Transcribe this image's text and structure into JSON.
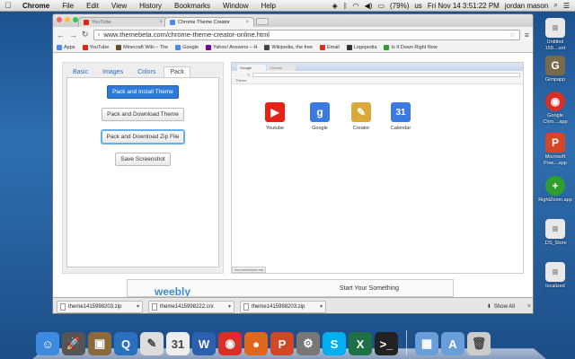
{
  "menubar": {
    "app": "Chrome",
    "items": [
      "File",
      "Edit",
      "View",
      "History",
      "Bookmarks",
      "Window",
      "Help"
    ],
    "battery": "(79%)",
    "lang": "us",
    "clock": "Fri Nov 14  3:51:22 PM",
    "user": "jordan mason"
  },
  "desktop": [
    {
      "label": "Untitled 159....ext",
      "icon": "document-icon",
      "color": "#e8e8e8",
      "glyph": "≡"
    },
    {
      "label": "Gimpapp",
      "icon": "gimp-icon",
      "color": "#7a6a4a",
      "glyph": "🐕"
    },
    {
      "label": "Google Chro....app",
      "icon": "chrome-icon",
      "color": "#d93025",
      "glyph": "◉"
    },
    {
      "label": "Microsoft Pow....app",
      "icon": "powerpoint-icon",
      "color": "#d24726",
      "glyph": "P"
    },
    {
      "label": "RightZoom.app",
      "icon": "rightzoom-icon",
      "color": "#2f9e2f",
      "glyph": "+"
    },
    {
      "label": ".DS_Store",
      "icon": "file-icon",
      "color": "#e8e8e8",
      "glyph": "≡"
    },
    {
      "label": "localized",
      "icon": "file-icon",
      "color": "#e8e8e8",
      "glyph": "≡"
    }
  ],
  "browser": {
    "tabs": [
      {
        "title": "YouTube",
        "active": false,
        "fav": "#e62117"
      },
      {
        "title": "Chrome Theme Creator",
        "active": true,
        "fav": "#4a8af4"
      }
    ],
    "url": "www.themebeta.com/chrome-theme-creator-online.html",
    "bookmarks": [
      {
        "label": "Apps",
        "color": "#4a8af4"
      },
      {
        "label": "YouTube",
        "color": "#e62117"
      },
      {
        "label": "Minecraft Wiki – The",
        "color": "#6b4f2a"
      },
      {
        "label": "Google",
        "color": "#4a8af4"
      },
      {
        "label": "Yahoo! Answers – H",
        "color": "#7b0099"
      },
      {
        "label": "Wikipedia, the free",
        "color": "#444444"
      },
      {
        "label": "Email",
        "color": "#d93025"
      },
      {
        "label": "Logopedia",
        "color": "#333333"
      },
      {
        "label": "Is It Down Right Now",
        "color": "#2f9e2f"
      }
    ]
  },
  "creator": {
    "tabs": [
      "Basic",
      "Images",
      "Colors",
      "Pack"
    ],
    "active_tab": "Pack",
    "buttons": {
      "pack_install": "Pack and Install Theme",
      "pack_download": "Pack and Download Theme",
      "pack_zip": "Pack and Download Zip File",
      "save_screenshot": "Save Screenshot"
    }
  },
  "preview": {
    "tabs": [
      "Google",
      "Chrome"
    ],
    "bookmark": "Theme",
    "apps": [
      {
        "label": "Youtube",
        "color": "#e62117",
        "glyph": "▶"
      },
      {
        "label": "Google",
        "color": "#3b7be0",
        "glyph": "g"
      },
      {
        "label": "Creator",
        "color": "#d9a93a",
        "glyph": "✎"
      },
      {
        "label": "Calendar",
        "color": "#3b7be0",
        "glyph": "31"
      }
    ],
    "status": "chromethemer.net"
  },
  "ad": {
    "logo": "weebly",
    "text": "Start Your Something"
  },
  "downloads": {
    "items": [
      "theme1415998203.zip",
      "theme1415998222.crx",
      "theme1415998203.zip"
    ],
    "show_all": "Show All"
  },
  "dock": [
    {
      "icon": "finder-icon",
      "color": "#3d8be0",
      "glyph": "☺"
    },
    {
      "icon": "launchpad-icon",
      "color": "#555555",
      "glyph": "🚀"
    },
    {
      "icon": "preview-icon",
      "color": "#8a6a3a",
      "glyph": "▣"
    },
    {
      "icon": "quicktime-icon",
      "color": "#2b6fbf",
      "glyph": "Q"
    },
    {
      "icon": "textedit-icon",
      "color": "#dddddd",
      "glyph": "✎"
    },
    {
      "icon": "ical-icon",
      "color": "#eeeeee",
      "glyph": "31"
    },
    {
      "icon": "word-icon",
      "color": "#2b5fb0",
      "glyph": "W"
    },
    {
      "icon": "chrome-icon",
      "color": "#d93025",
      "glyph": "◉"
    },
    {
      "icon": "firefox-icon",
      "color": "#e0661b",
      "glyph": "●"
    },
    {
      "icon": "powerpoint-icon",
      "color": "#d24726",
      "glyph": "P"
    },
    {
      "icon": "system-preferences-icon",
      "color": "#777777",
      "glyph": "⚙"
    },
    {
      "icon": "skype-icon",
      "color": "#00aff0",
      "glyph": "S"
    },
    {
      "icon": "excel-icon",
      "color": "#1e7145",
      "glyph": "X"
    },
    {
      "icon": "terminal-icon",
      "color": "#222222",
      "glyph": ">_"
    },
    {
      "icon": "downloads-stack-icon",
      "color": "#6a9ed8",
      "glyph": "▦"
    },
    {
      "icon": "applications-stack-icon",
      "color": "#6a9ed8",
      "glyph": "A"
    },
    {
      "icon": "trash-icon",
      "color": "#cccccc",
      "glyph": "🗑"
    }
  ]
}
